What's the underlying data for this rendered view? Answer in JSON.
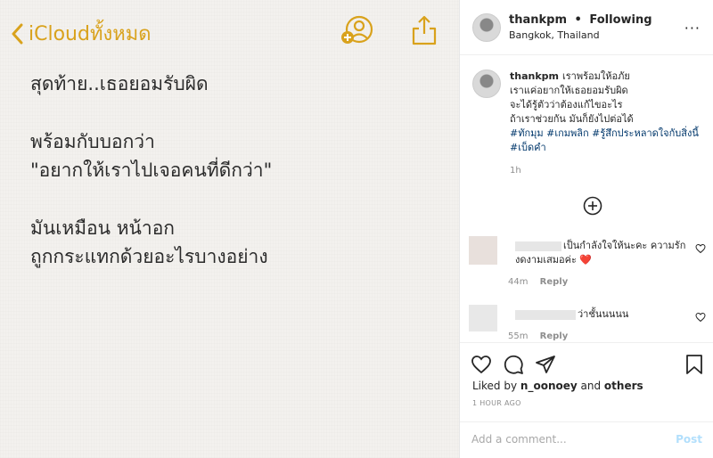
{
  "note": {
    "back_label": "iCloudทั้งหมด",
    "lines_block1": [
      "สุดท้าย..เธอยอมรับผิด"
    ],
    "lines_block2": [
      "พร้อมกับบอกว่า",
      "\"อยากให้เราไปเจอคนที่ดีกว่า\""
    ],
    "lines_block3": [
      "มันเหมือน หน้าอก",
      "ถูกกระแทกด้วยอะไรบางอย่าง"
    ],
    "accent_color": "#d9a21c"
  },
  "post": {
    "username": "thankpm",
    "follow_sep": "•",
    "follow_status": "Following",
    "location": "Bangkok, Thailand",
    "more": "···",
    "caption": {
      "username": "thankpm",
      "line1": "เราพร้อมให้อภัย",
      "line2": "เราแค่อยากให้เธอยอมรับผิด",
      "line3": "จะได้รู้ตัวว่าต้องแก้ไขอะไร",
      "line4": "ถ้าเราช่วยกัน มันก็ยังไปต่อได้",
      "tags_line1": "#ทักมุม #เกมพลิก #รู้สึกประหลาดใจกับสิ่งนี้",
      "tags_line2": "#เบ็ดคำ",
      "time": "1h"
    },
    "comments": [
      {
        "text_line1": "เป็นกำลังใจให้นะคะ ความรัก",
        "text_line2": "งดงามเสมอค่ะ ❤️",
        "time": "44m",
        "reply": "Reply"
      },
      {
        "text_line1": "ว่าชั้นนนนน",
        "time": "55m",
        "reply": "Reply"
      }
    ],
    "liked_by_prefix": "Liked by",
    "liked_by_user": "n_oonoey",
    "liked_by_and": "and",
    "liked_by_others": "others",
    "ago": "1 HOUR AGO",
    "comment_placeholder": "Add a comment...",
    "post_label": "Post"
  }
}
